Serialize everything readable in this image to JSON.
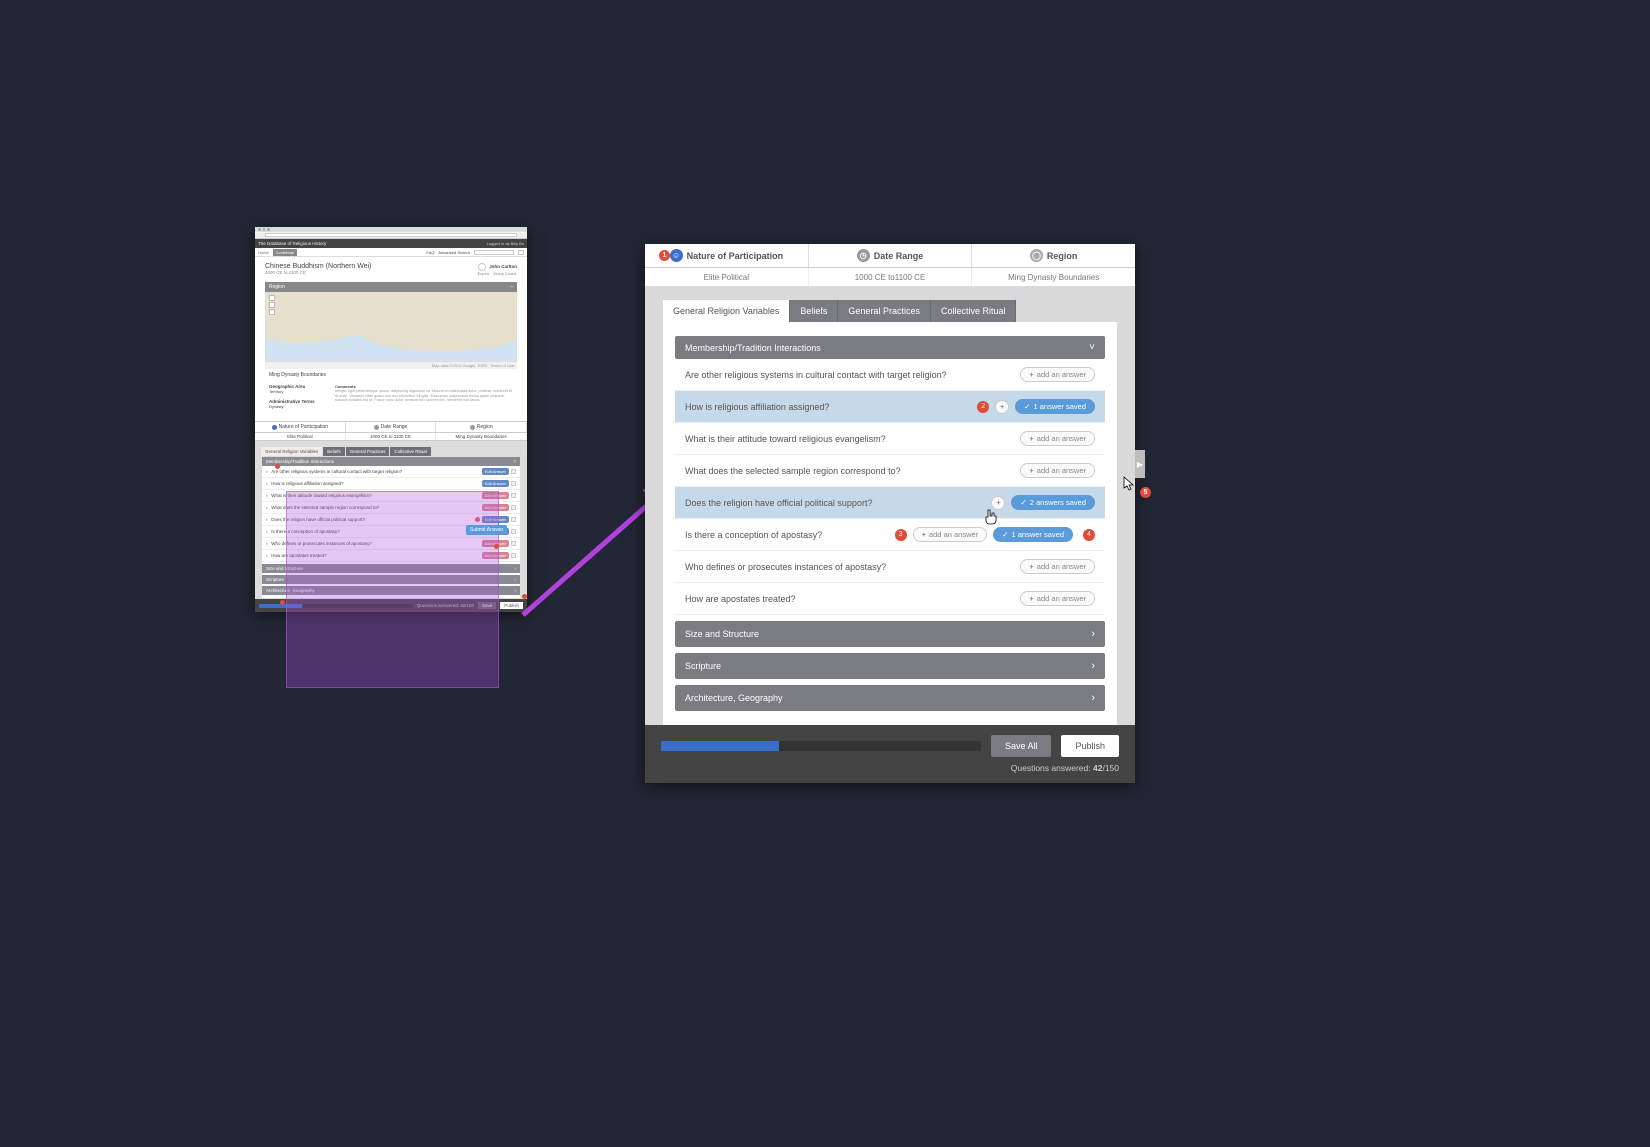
{
  "thumb": {
    "brand": "The Database of Religious History",
    "login": "Logged in as Billy Bo",
    "nav": {
      "home": "Home",
      "contribute": "Contribute",
      "faq": "FAQ",
      "advanced": "Advanced Search",
      "search_placeholder": "Search all existing entries...",
      "go": "Go"
    },
    "title": "Chinese Buddhism (Northern Wei)",
    "subtitle": "1000 CE to 1100 CE",
    "author": {
      "name": "John Carlton",
      "role": "Expert · Group Coord."
    },
    "region_bar": "Region",
    "map_footer": "Map data ©2014 Google, ESRI · Terms of Use",
    "map_label": "Ming Dynasty Boundaries",
    "meta": {
      "geo_label": "Geographic Area",
      "geo_val": "Territory",
      "admin_label": "Administrative Terms",
      "admin_val": "Dynasty",
      "comments_label": "Comments",
      "comments_text": "Integer eget pellentesque ipsum, adipiscing dignissim mi. Mauris id malesuada dolor, pulvinar hendrerit et at enim. Vivamus vitae quam nec nisi bibendum fringilla. Maecenas malesuada lectus quam posuere, suscipit sodales est ut. Fusce nunc dolor, pretium nec laoreet nec, hendrerit non lacus."
    },
    "sec": {
      "c1": "Nature of Participation",
      "c2": "Date Range",
      "c3": "Region",
      "v1": "Elite Political",
      "v2": "1000 CE to 1100 CE",
      "v3": "Ming Dynasty Boundaries"
    },
    "tabs": [
      "General Religion Variables",
      "Beliefs",
      "General Practices",
      "Collective Ritual"
    ],
    "group": "Membership/Tradition Interactions",
    "questions": [
      {
        "t": "Are other religious systems in cultural contact with target religion?",
        "btn": "Edit Answer",
        "type": "edit",
        "tog": true
      },
      {
        "t": "How is religious affiliation assigned?",
        "btn": "Edit Answer",
        "type": "edit",
        "tog": true
      },
      {
        "t": "What is their attitude toward religious evangelism?",
        "btn": "Add Answer",
        "type": "add",
        "tog": true
      },
      {
        "t": "What does the selected sample region correspond to?",
        "btn": "Add Answer",
        "type": "add",
        "tog": true
      },
      {
        "t": "Does the religion have official political support?",
        "btn": "Edit Answer",
        "type": "edit",
        "badge": true,
        "tog": true
      },
      {
        "t": "Is there a conception of apostasy?",
        "btn": "Edit Answer",
        "type": "edit",
        "tog": true
      },
      {
        "t": "Who defines or prosecutes instances of apostasy?",
        "btn": "Add Answer",
        "type": "add",
        "tog": true
      },
      {
        "t": "How are apostates treated?",
        "btn": "Add Answer",
        "type": "add",
        "tog": true
      }
    ],
    "submit_tip": "Submit Answer",
    "subgroups": [
      "Size and Structure",
      "Scripture",
      "Architecture, Geography"
    ],
    "foot_count": "Questions answered: 42/150",
    "save": "Save",
    "publish": "Publish"
  },
  "big": {
    "hdr": {
      "c1": "Nature of Participation",
      "c2": "Date Range",
      "c3": "Region"
    },
    "vals": {
      "v1": "Elite Political",
      "v2": "1000 CE to1100 CE",
      "v3": "Ming Dynasty Boundaries"
    },
    "tabs": [
      "General Religion Variables",
      "Beliefs",
      "General Practices",
      "Collective Ritual"
    ],
    "group": "Membership/Tradition Interactions",
    "add_label": "add an answer",
    "questions": [
      {
        "t": "Are other religious systems in cultural contact with target religion?",
        "action": "add"
      },
      {
        "t": "How is religious affiliation assigned?",
        "hl": true,
        "badge": "2",
        "addcircle": true,
        "saved": "1 answer saved"
      },
      {
        "t": "What is their attitude toward religious evangelism?",
        "action": "add"
      },
      {
        "t": "What does the selected sample region correspond to?",
        "action": "add"
      },
      {
        "t": "Does the religion have official political support?",
        "hl": true,
        "addcircle": true,
        "saved": "2 answers saved"
      },
      {
        "t": "Is there a conception of apostasy?",
        "badge": "3",
        "action": "add",
        "saved": "1 answer saved",
        "marker": "4"
      },
      {
        "t": "Who defines or prosecutes instances of apostasy?",
        "action": "add"
      },
      {
        "t": "How are apostates treated?",
        "action": "add"
      }
    ],
    "subgroups": [
      "Size and Structure",
      "Scripture",
      "Architecture, Geography"
    ],
    "count_prefix": "Questions answered: ",
    "count_num": "42",
    "count_total": "/150",
    "save": "Save All",
    "publish": "Publish",
    "marker1": "1",
    "marker5": "5"
  }
}
